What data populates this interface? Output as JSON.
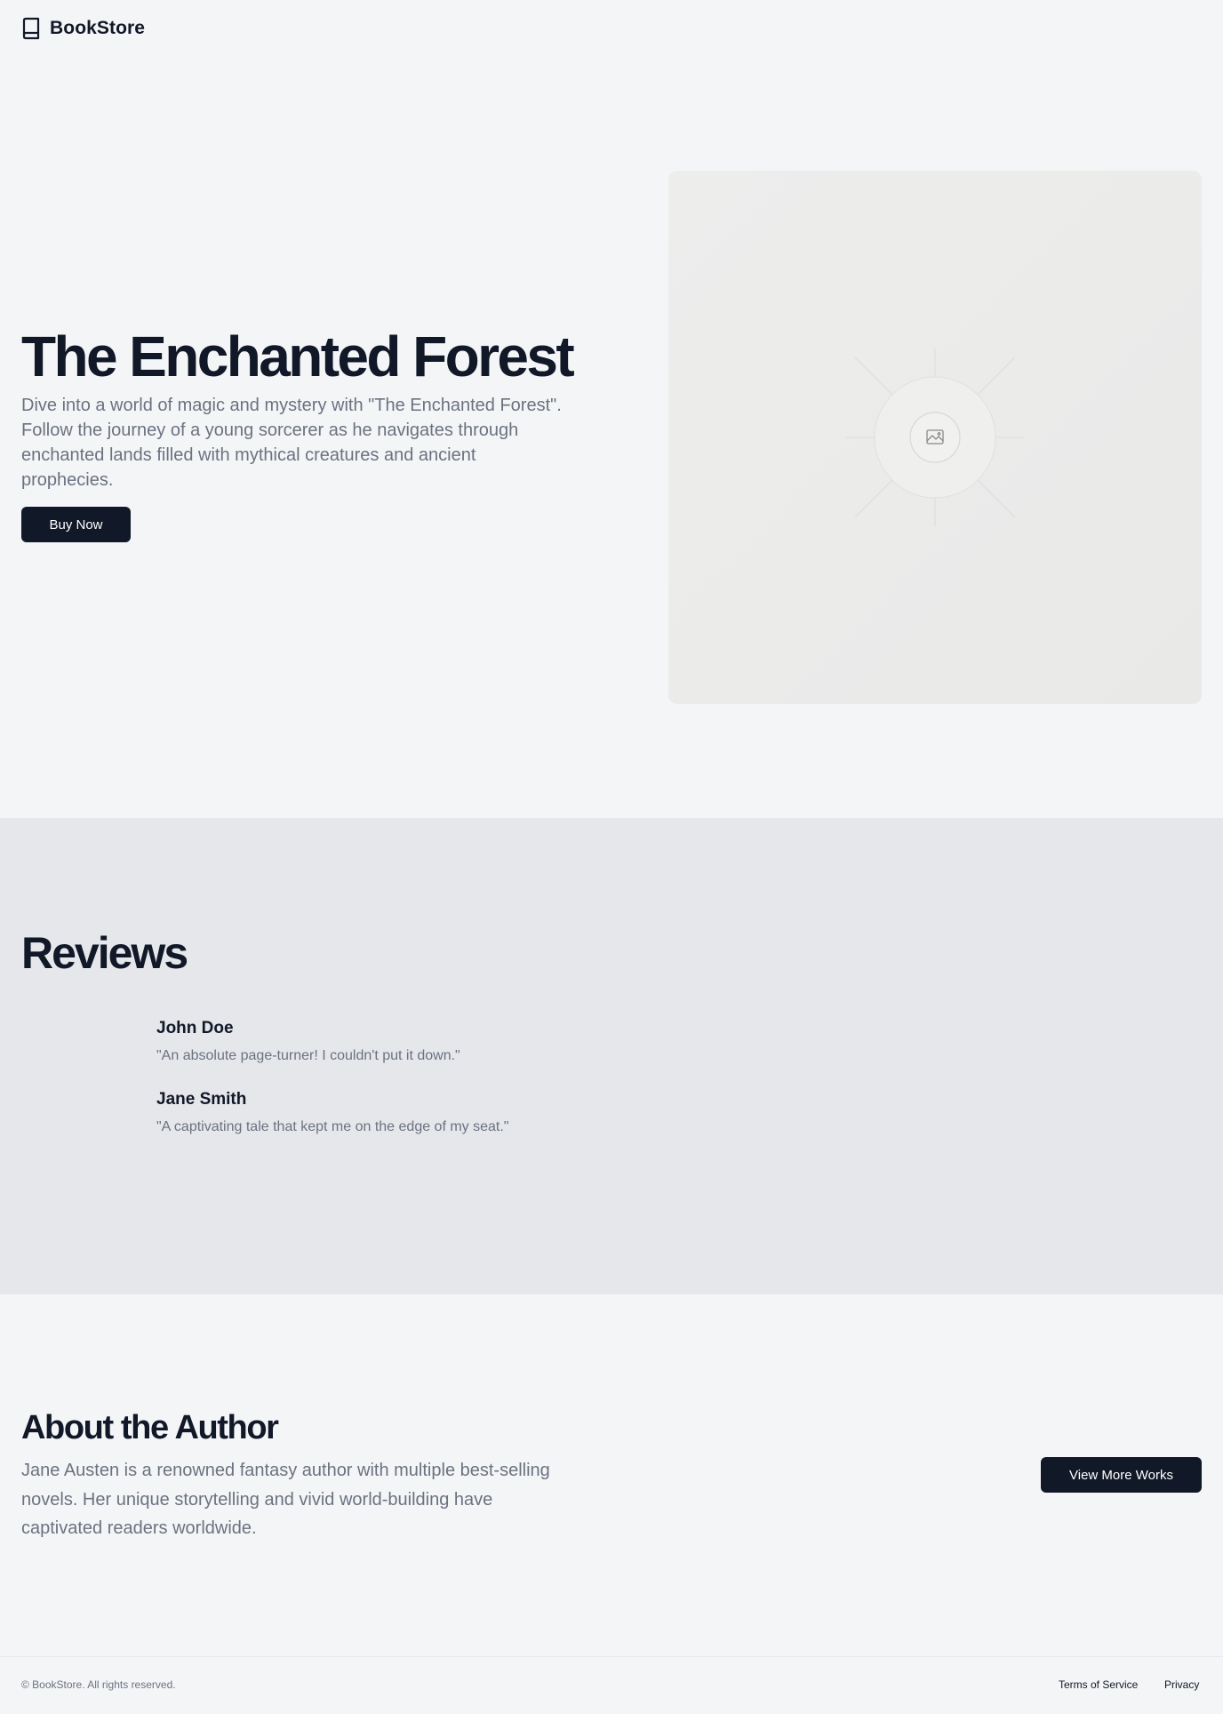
{
  "header": {
    "brand": "BookStore",
    "logo_icon": "book-icon"
  },
  "hero": {
    "title": "The Enchanted Forest",
    "description": "Dive into a world of magic and mystery with \"The Enchanted Forest\". Follow the journey of a young sorcerer as he navigates through enchanted lands filled with mythical creatures and ancient prophecies.",
    "buy_label": "Buy Now",
    "image_icon": "image-placeholder-icon"
  },
  "reviews": {
    "title": "Reviews",
    "items": [
      {
        "name": "John Doe",
        "text": "\"An absolute page-turner! I couldn't put it down.\""
      },
      {
        "name": "Jane Smith",
        "text": "\"A captivating tale that kept me on the edge of my seat.\""
      }
    ]
  },
  "about": {
    "title": "About the Author",
    "description": "Jane Austen is a renowned fantasy author with multiple best-selling novels. Her unique storytelling and vivid world-building have captivated readers worldwide.",
    "more_label": "View More Works"
  },
  "footer": {
    "copyright": "© BookStore. All rights reserved.",
    "links": [
      "Terms of Service",
      "Privacy"
    ]
  },
  "colors": {
    "background": "#f4f5f7",
    "section_alt": "#e5e7eb",
    "primary": "#111827",
    "muted_text": "#6b7280"
  }
}
